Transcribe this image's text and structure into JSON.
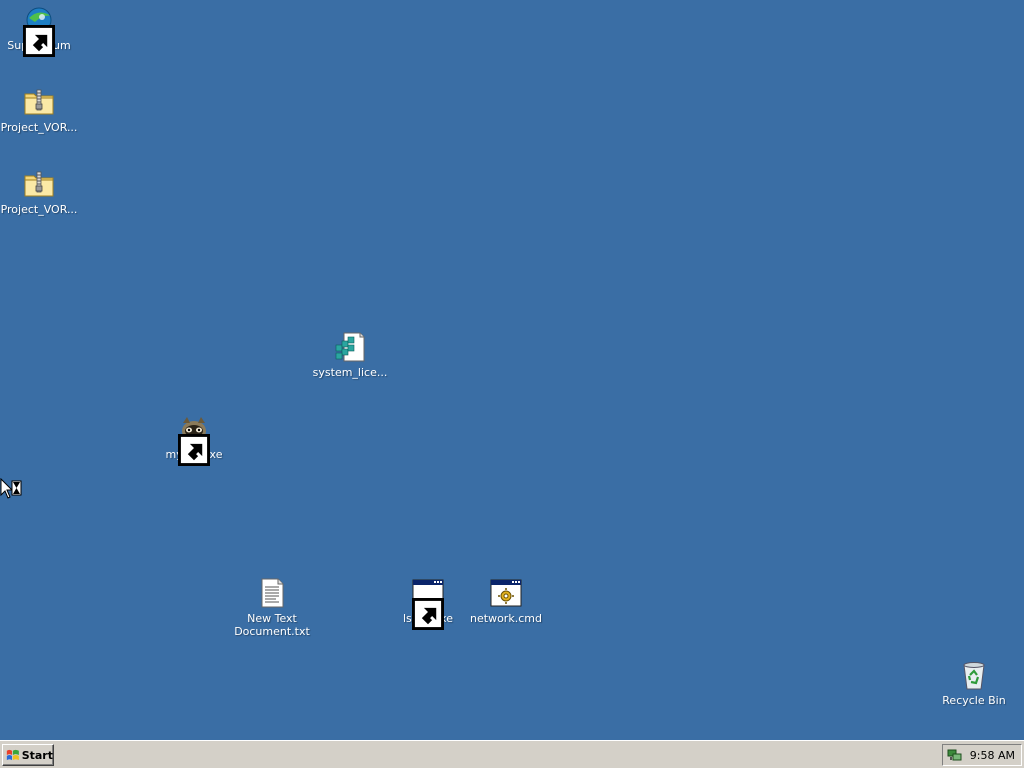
{
  "desktop": {
    "background_color": "#3a6ea5",
    "icons": [
      {
        "label": "Supermium",
        "icon": "supermium-browser-icon",
        "shortcut": true
      },
      {
        "label": "Project_VOR...",
        "icon": "zip-folder-icon",
        "shortcut": false
      },
      {
        "label": "Project_VOR...",
        "icon": "zip-folder-icon",
        "shortcut": false
      },
      {
        "label": "system_lice...",
        "icon": "registry-file-icon",
        "shortcut": false
      },
      {
        "label": "mypal.exe",
        "icon": "mypal-raccoon-icon",
        "shortcut": true
      },
      {
        "label": "New Text\nDocument.txt",
        "icon": "text-document-icon",
        "shortcut": false
      },
      {
        "label": "lsass.exe",
        "icon": "application-window-icon",
        "shortcut": true
      },
      {
        "label": "network.cmd",
        "icon": "batch-file-icon",
        "shortcut": false
      },
      {
        "label": "Recycle Bin",
        "icon": "recycle-bin-icon",
        "shortcut": false
      }
    ]
  },
  "taskbar": {
    "start_label": "Start",
    "clock": "9:58 AM",
    "tray_icon": "network-tray-icon"
  },
  "cursor": "busy-arrow-cursor-icon"
}
